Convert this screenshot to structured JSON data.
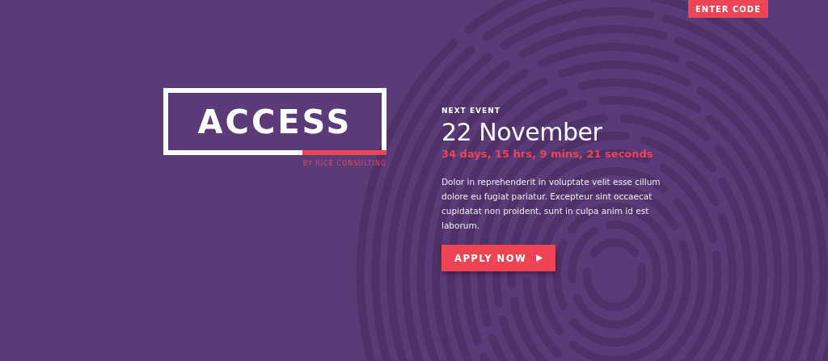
{
  "header": {
    "enter_code_button": "ENTER CODE"
  },
  "logo": {
    "wordmark": "ACCESS",
    "byline": "BY RICE CONSULTING"
  },
  "event": {
    "eyebrow": "NEXT EVENT",
    "date": "22 November",
    "countdown": "34 days, 15 hrs, 9 mins, 21 seconds",
    "description": "Dolor in reprehenderit in voluptate velit esse cillum dolore eu fugiat pariatur. Excepteur sint occaecat cupidatat non proident, sunt in culpa anim id est laborum.",
    "apply_button": "APPLY NOW"
  }
}
